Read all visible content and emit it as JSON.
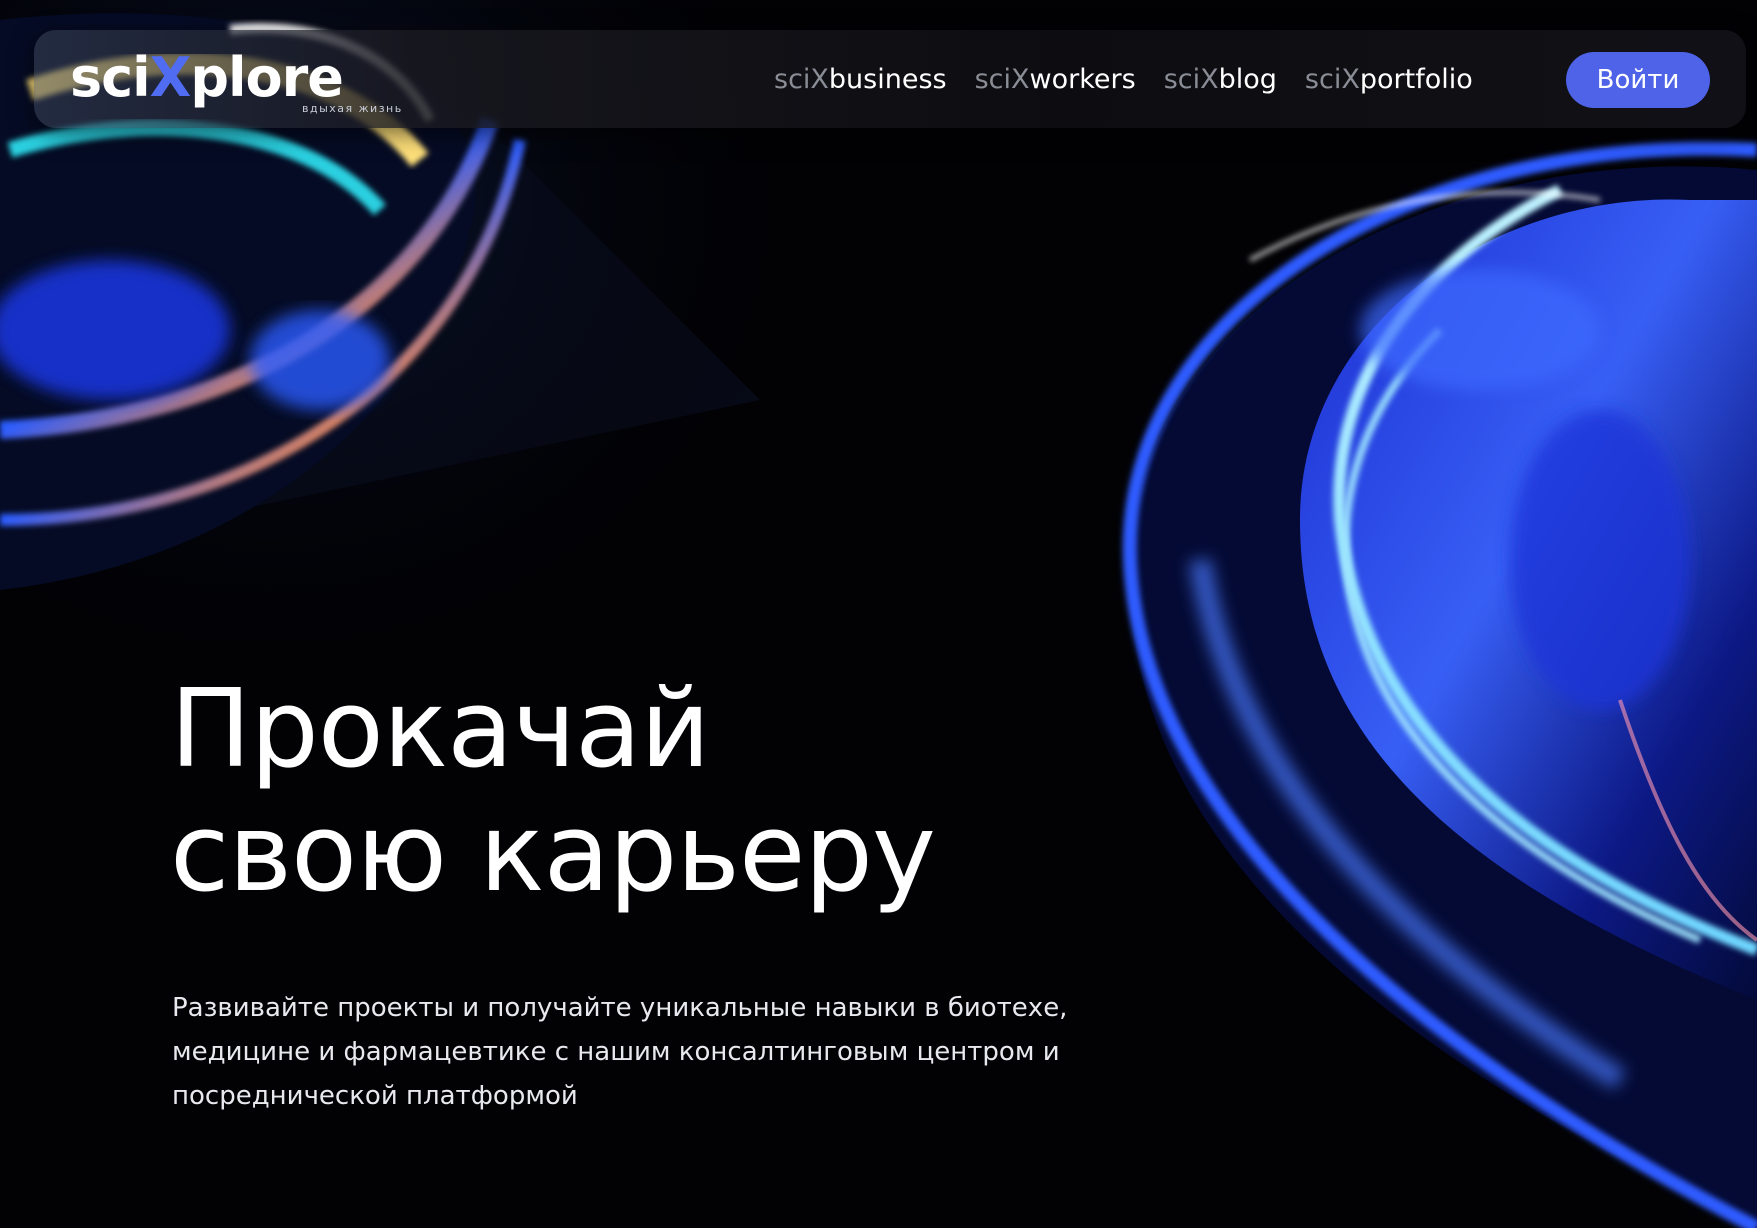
{
  "brand": {
    "name_prefix": "sci",
    "name_x": "X",
    "name_suffix": "plore",
    "tagline": "вдыхая жизнь",
    "accent": "#4f6cf2"
  },
  "nav": {
    "items": [
      {
        "prefix": "sciX",
        "label": "business"
      },
      {
        "prefix": "sciX",
        "label": "workers"
      },
      {
        "prefix": "sciX",
        "label": "blog"
      },
      {
        "prefix": "sciX",
        "label": "portfolio"
      }
    ],
    "login_label": "Войти",
    "login_color": "#4e63e8"
  },
  "hero": {
    "title_line1": "Прокачай",
    "title_line2": "свою карьеру",
    "subtitle_lines": [
      "Развивайте проекты и получайте уникальные навыки в биотехе,",
      "медицине и фармацевтике с нашим консалтинговым центром и",
      "посреднической платформой"
    ]
  },
  "decor": {
    "left_art": "iridescent-glass-sphere",
    "right_art": "blue-glass-swirl"
  }
}
